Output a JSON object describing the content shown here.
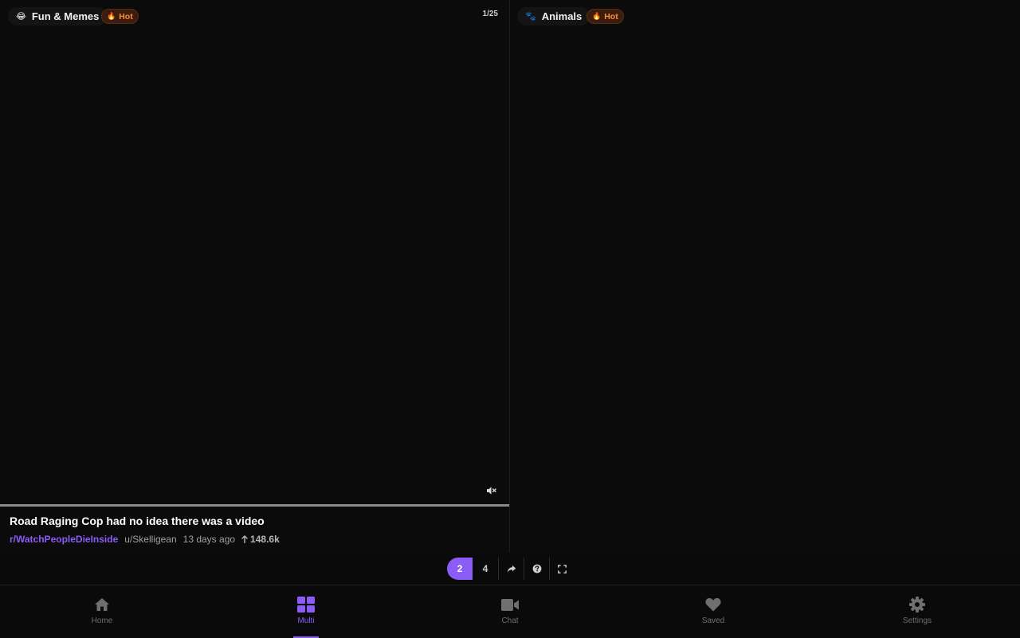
{
  "left_feed": {
    "feed_emoji": "😂",
    "feed_name": "Fun & Memes",
    "sort_label": "Hot",
    "counter": "1/25",
    "video_progress": 1.0,
    "post": {
      "title": "Road Raging Cop had no idea there was a video",
      "subreddit": "r/WatchPeopleDieInside",
      "author": "u/Skelligean",
      "age": "13 days ago",
      "score": "148.6k"
    }
  },
  "right_feed": {
    "feed_emoji": "🐾",
    "feed_name": "Animals",
    "sort_label": "Hot"
  },
  "controls": {
    "layout_2": "2",
    "layout_4": "4"
  },
  "nav": {
    "items": [
      {
        "label": "Home",
        "icon": "home-icon"
      },
      {
        "label": "Multi",
        "icon": "grid-icon",
        "active": true
      },
      {
        "label": "Chat",
        "icon": "video-camera-icon"
      },
      {
        "label": "Saved",
        "icon": "heart-icon"
      },
      {
        "label": "Settings",
        "icon": "gear-icon"
      }
    ]
  },
  "colors": {
    "accent": "#8b5cf6",
    "hot": "#ff8a3d",
    "background": "#0a0a0a"
  }
}
